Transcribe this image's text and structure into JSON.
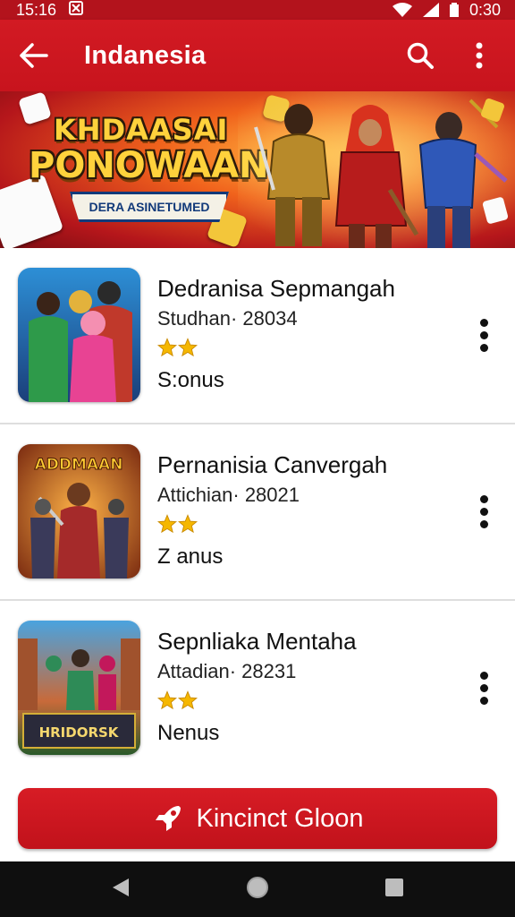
{
  "status_bar": {
    "time": "15:16",
    "right_time": "0:30"
  },
  "app_bar": {
    "title": "Indanesia"
  },
  "banner": {
    "logo_line1": "KHDAASAI",
    "logo_line2": "PONOWAAN",
    "ribbon_text": "DERA ASINETUMED"
  },
  "games": [
    {
      "name": "Dedranisa Sepmangah",
      "studio": "Studhan· 28034",
      "stars": 2,
      "bonus": "S:onus"
    },
    {
      "name": "Pernanisia Canvergah",
      "studio": "Attichian· 28021",
      "stars": 2,
      "bonus": "Z anus",
      "thumb_title": "ADDMAAN"
    },
    {
      "name": "Sepnliaka Mentaha",
      "studio": "Attadian· 28231",
      "stars": 2,
      "bonus": "Nenus",
      "thumb_title": "HRIDORSK"
    }
  ],
  "cta": {
    "label": "Kincinct Gloon"
  },
  "colors": {
    "brand_red": "#d21a23",
    "star_gold": "#f5b700"
  },
  "icons": {
    "back": "arrow-left-icon",
    "search": "search-icon",
    "menu": "more-vert-icon",
    "cta": "rocket-icon",
    "nav_back": "triangle-back-icon",
    "nav_home": "circle-home-icon",
    "nav_recent": "square-recent-icon"
  }
}
